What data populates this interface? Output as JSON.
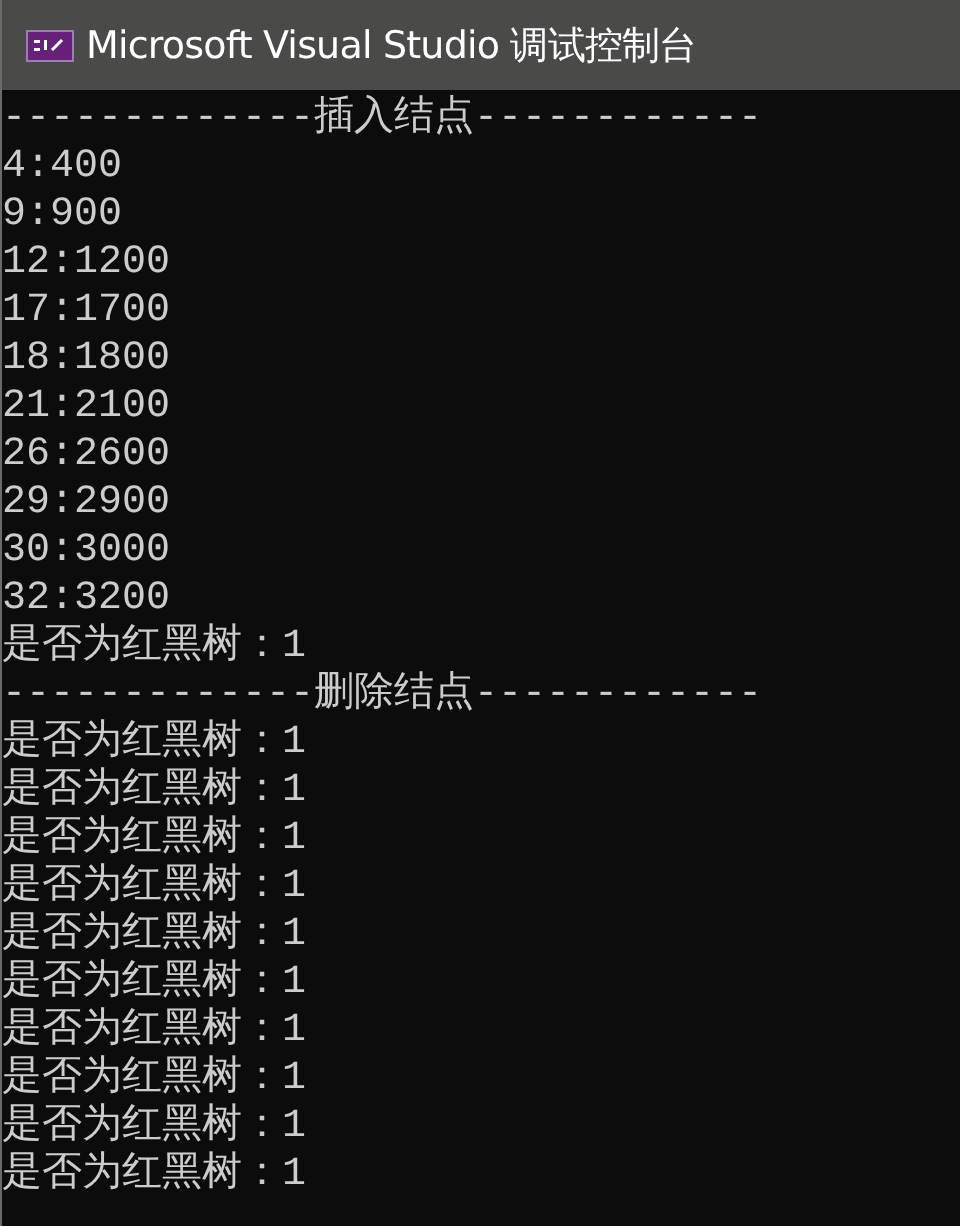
{
  "window": {
    "title": "Microsoft Visual Studio 调试控制台"
  },
  "console": {
    "lines": [
      "-------------插入结点------------",
      "4:400",
      "9:900",
      "12:1200",
      "17:1700",
      "18:1800",
      "21:2100",
      "26:2600",
      "29:2900",
      "30:3000",
      "32:3200",
      "是否为红黑树：1",
      "-------------删除结点------------",
      "是否为红黑树：1",
      "是否为红黑树：1",
      "是否为红黑树：1",
      "是否为红黑树：1",
      "是否为红黑树：1",
      "是否为红黑树：1",
      "是否为红黑树：1",
      "是否为红黑树：1",
      "是否为红黑树：1",
      "是否为红黑树：1"
    ]
  }
}
